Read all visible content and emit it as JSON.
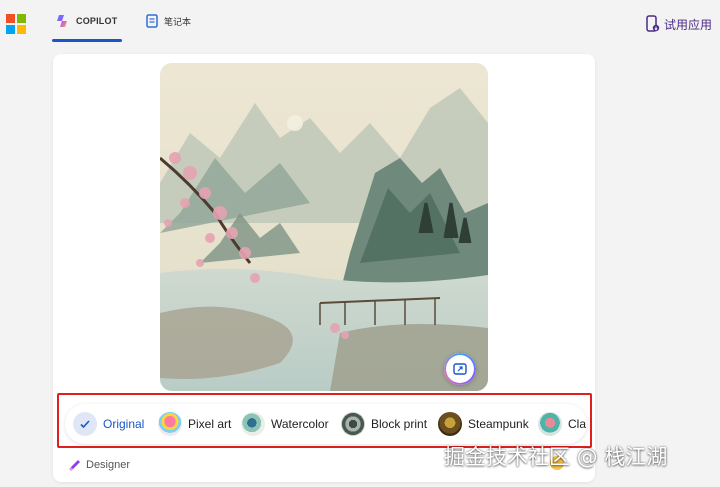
{
  "header": {
    "tabs": [
      {
        "label": "COPILOT",
        "active": true
      },
      {
        "label": "笔记本",
        "active": false
      }
    ],
    "try_app_label": "试用应用"
  },
  "image_alt": "Chinese ink-wash landscape with misty mountains, pink blossoms and a wooden bridge",
  "styles": [
    {
      "label": "Original",
      "selected": true
    },
    {
      "label": "Pixel art"
    },
    {
      "label": "Watercolor"
    },
    {
      "label": "Block print"
    },
    {
      "label": "Steampunk"
    },
    {
      "label": "Cla"
    }
  ],
  "footer": {
    "designer_label": "Designer"
  },
  "watermark": "掘金技术社区 @ 栈江湖",
  "colors": {
    "accent": "#1a56c4",
    "highlight": "#e02020",
    "try_app": "#4b2a86"
  }
}
